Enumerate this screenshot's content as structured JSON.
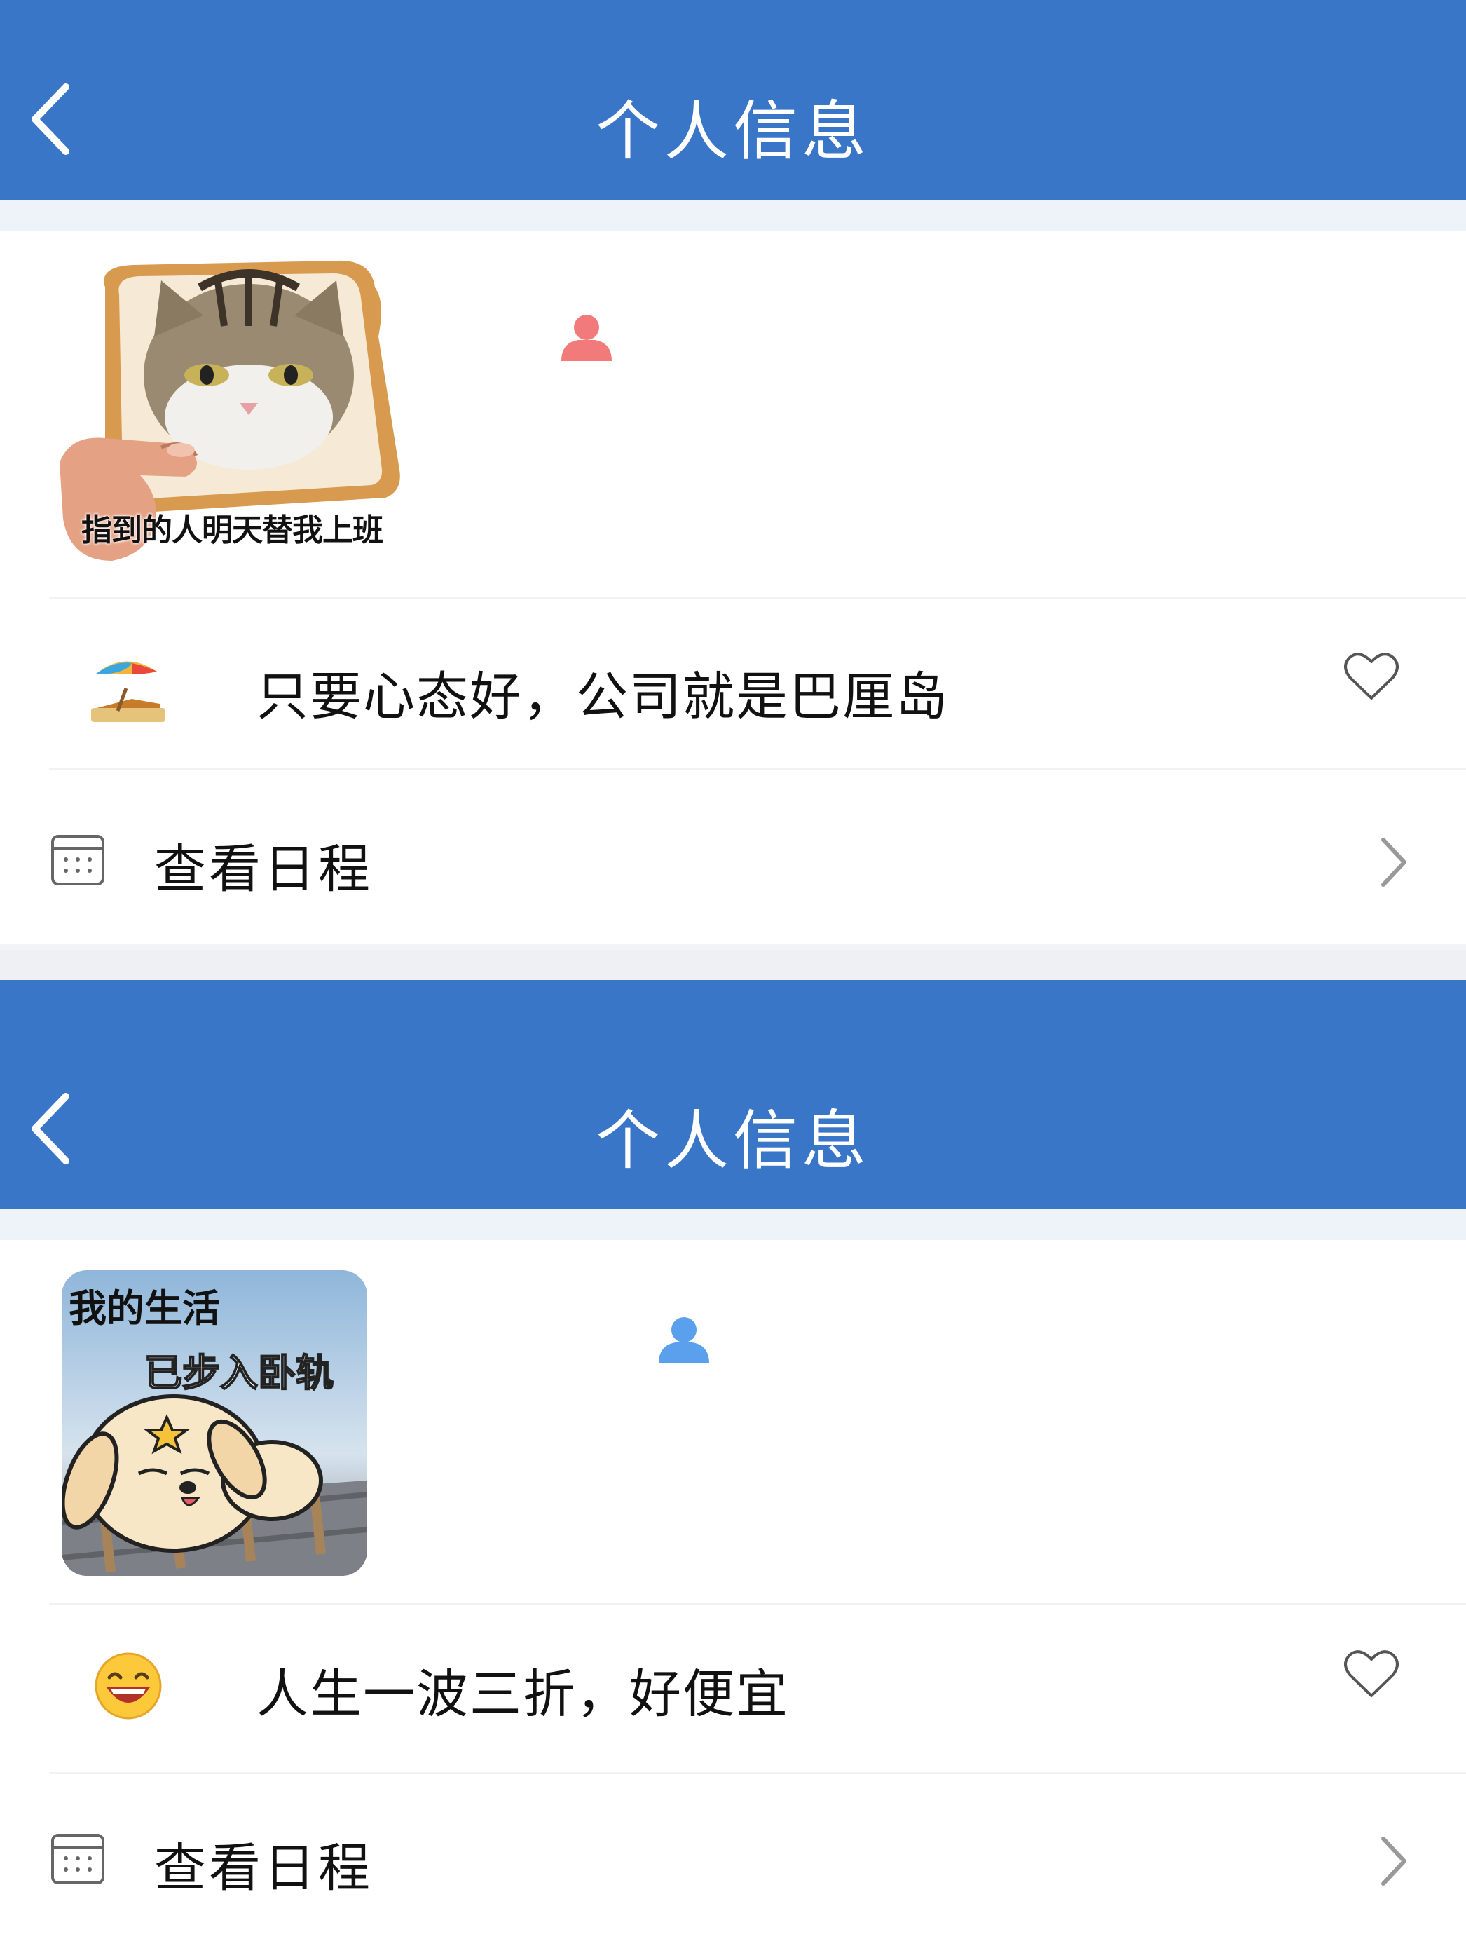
{
  "colors": {
    "header_bg": "#3a76c8",
    "header_text": "#ffffff",
    "separator": "#eef0f4",
    "person_icon_1": "#f27a7a",
    "person_icon_2": "#5aa0ec"
  },
  "profiles": [
    {
      "header": {
        "back_icon": "chevron-left-icon",
        "title": "个人信息"
      },
      "avatar": {
        "caption": "指到的人明天替我上班"
      },
      "gender_icon": "person-icon",
      "status": {
        "emoji": "beach-umbrella-icon",
        "text": "只要心态好，公司就是巴厘岛",
        "like_icon": "heart-outline-icon"
      },
      "schedule": {
        "icon": "calendar-icon",
        "label": "查看日程",
        "chevron_icon": "chevron-right-icon"
      }
    },
    {
      "header": {
        "back_icon": "chevron-left-icon",
        "title": "个人信息"
      },
      "avatar": {
        "caption_line1": "我的生活",
        "caption_line2": "已步入卧轨"
      },
      "gender_icon": "person-icon",
      "status": {
        "emoji": "grinning-face-icon",
        "text": "人生一波三折，好便宜",
        "like_icon": "heart-outline-icon"
      },
      "schedule": {
        "icon": "calendar-icon",
        "label": "查看日程",
        "chevron_icon": "chevron-right-icon"
      }
    }
  ]
}
